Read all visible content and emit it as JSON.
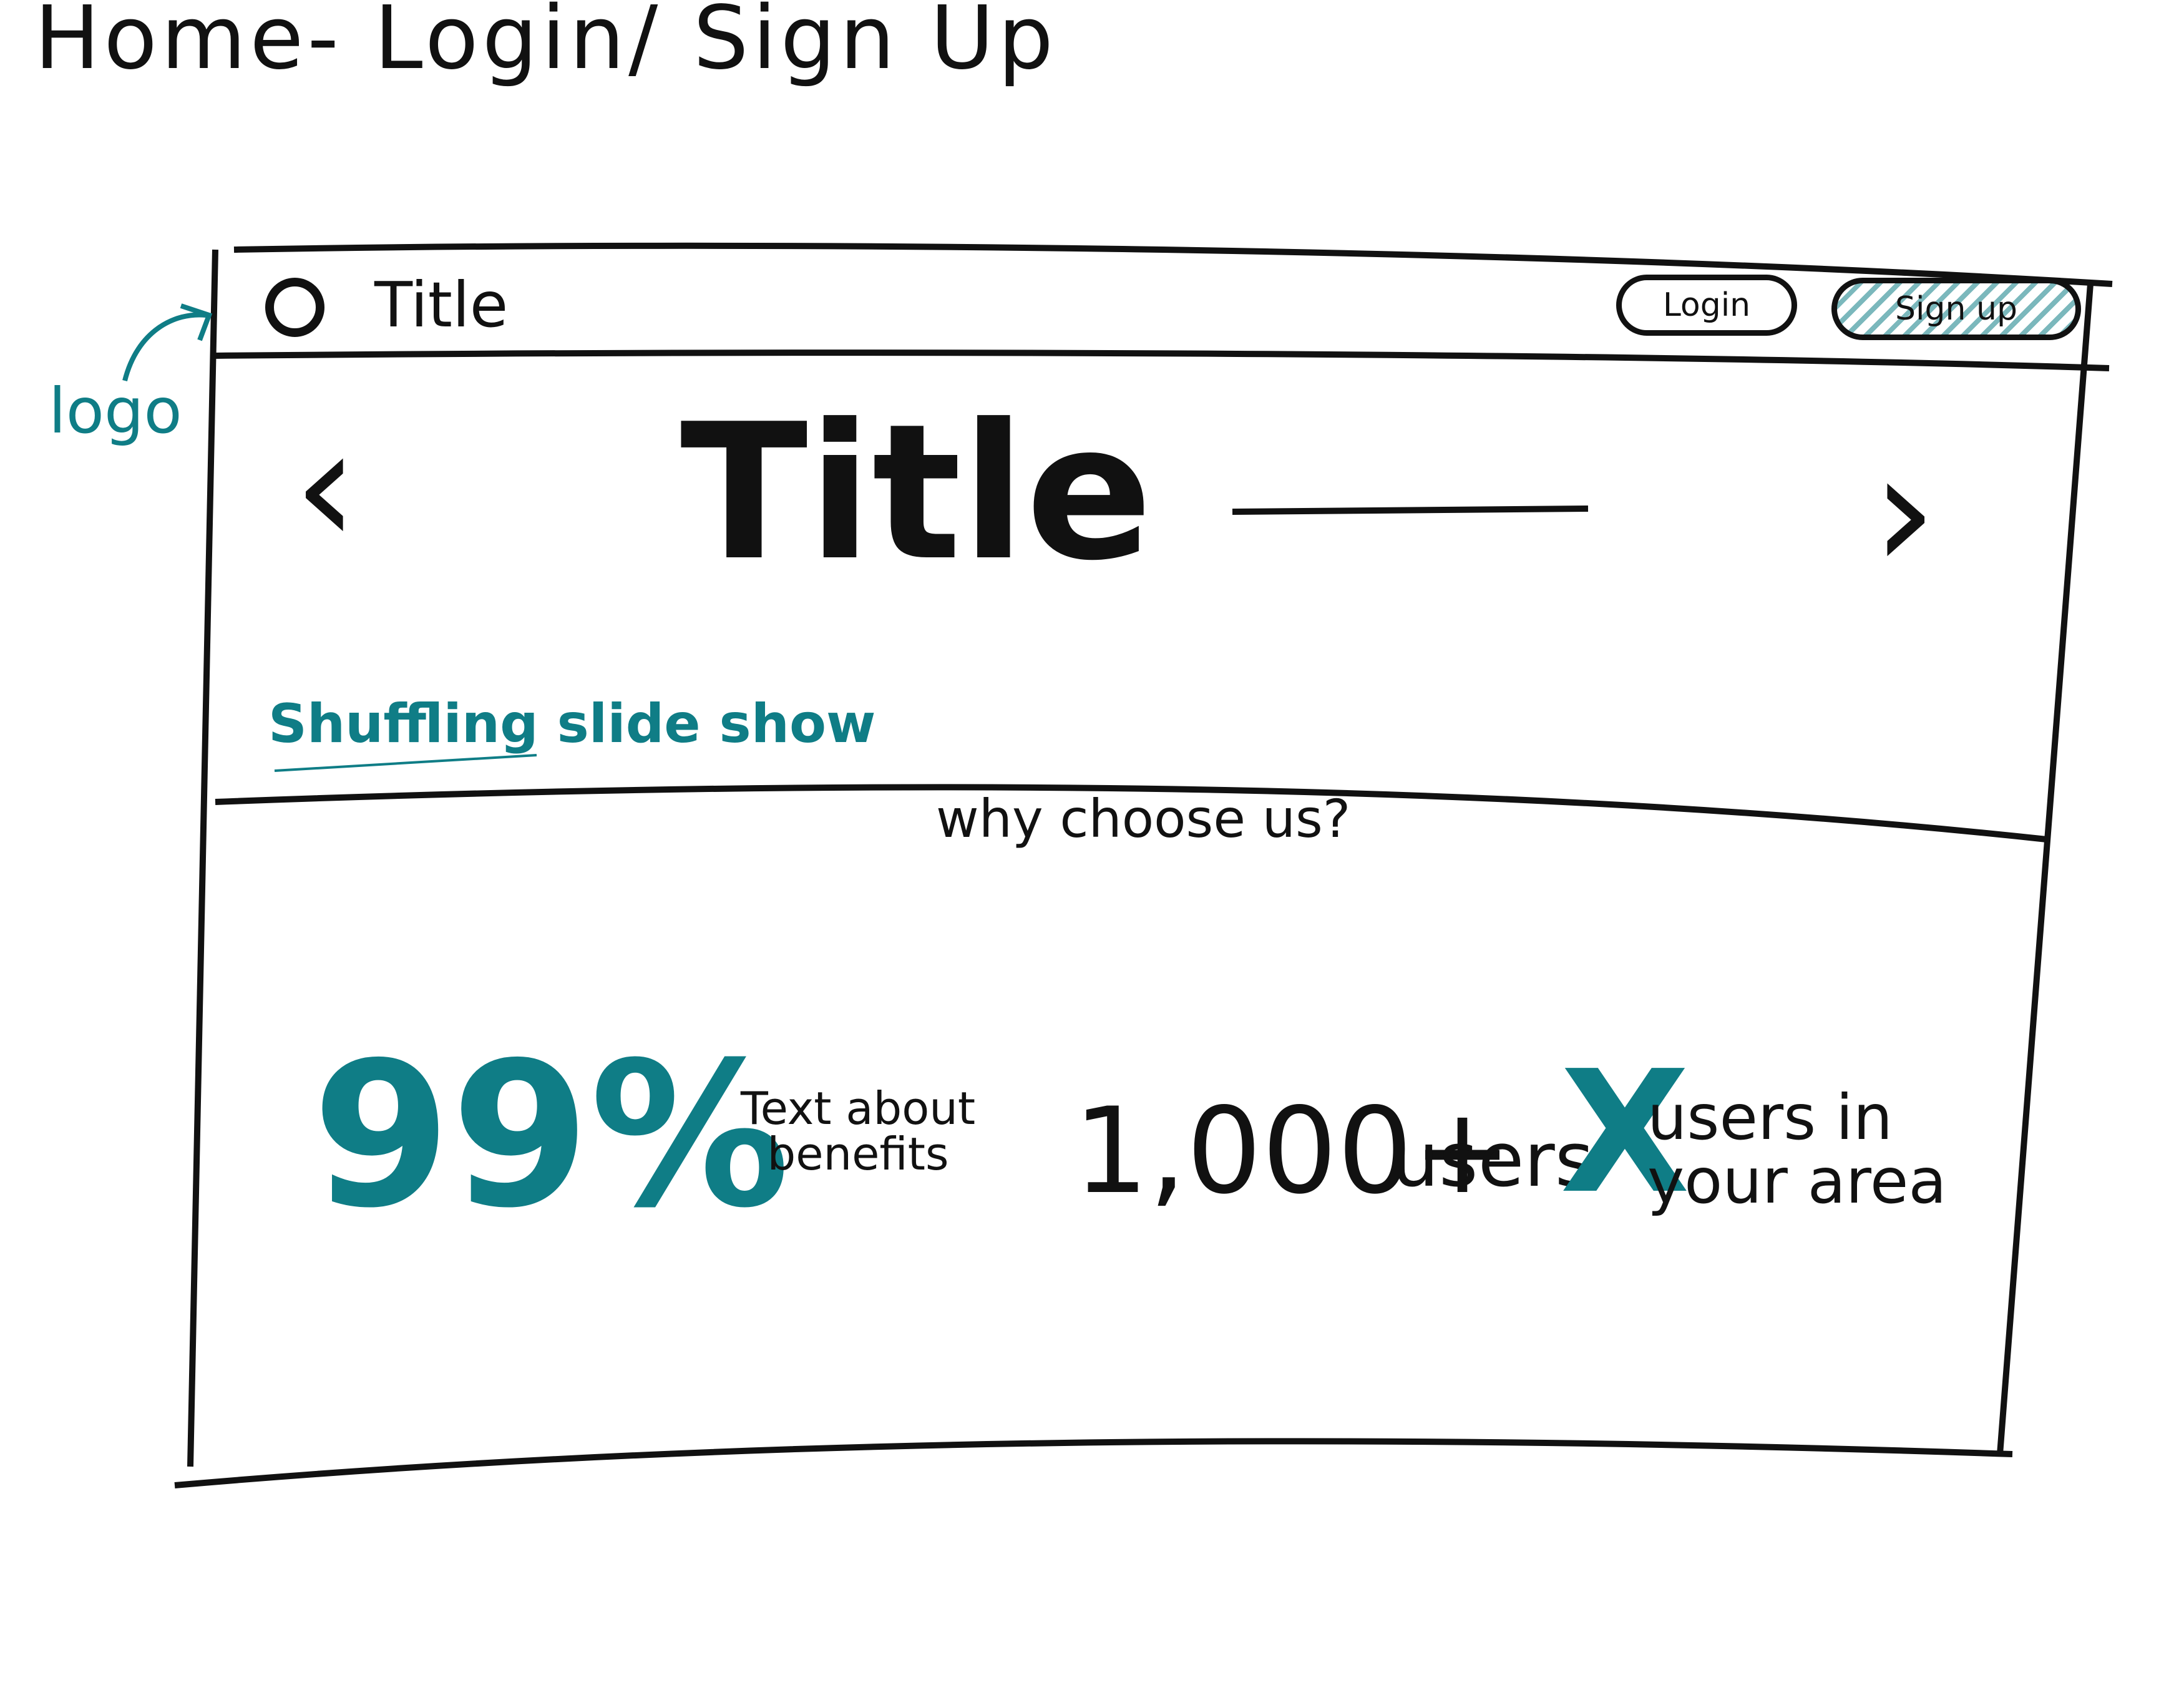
{
  "page_heading": "Home- Login/ Sign Up",
  "annotations": {
    "logo_label": "logo",
    "slideshow_label": "Shuffling slide show"
  },
  "header": {
    "logo_icon": "circle-logo-icon",
    "title": "Title",
    "login_label": "Login",
    "signup_label": "Sign up"
  },
  "hero": {
    "title": "Title",
    "prev_icon": "chevron-left-icon",
    "next_icon": "chevron-right-icon"
  },
  "why": {
    "heading": "why choose us?"
  },
  "stats": {
    "percent": "99%",
    "benefits_text": "Text about benefits",
    "users_count": "1,000+",
    "users_label": "users",
    "area_value": "X",
    "area_text": "users in your area"
  },
  "colors": {
    "ink": "#111111",
    "accent_teal": "#0f7d86"
  }
}
